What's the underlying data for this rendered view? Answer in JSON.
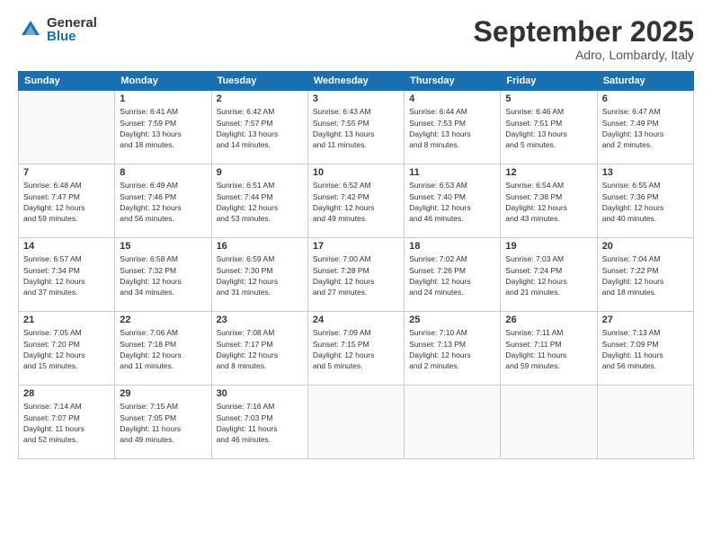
{
  "logo": {
    "general": "General",
    "blue": "Blue"
  },
  "title": "September 2025",
  "location": "Adro, Lombardy, Italy",
  "days_header": [
    "Sunday",
    "Monday",
    "Tuesday",
    "Wednesday",
    "Thursday",
    "Friday",
    "Saturday"
  ],
  "weeks": [
    [
      {
        "day": "",
        "info": ""
      },
      {
        "day": "1",
        "info": "Sunrise: 6:41 AM\nSunset: 7:59 PM\nDaylight: 13 hours\nand 18 minutes."
      },
      {
        "day": "2",
        "info": "Sunrise: 6:42 AM\nSunset: 7:57 PM\nDaylight: 13 hours\nand 14 minutes."
      },
      {
        "day": "3",
        "info": "Sunrise: 6:43 AM\nSunset: 7:55 PM\nDaylight: 13 hours\nand 11 minutes."
      },
      {
        "day": "4",
        "info": "Sunrise: 6:44 AM\nSunset: 7:53 PM\nDaylight: 13 hours\nand 8 minutes."
      },
      {
        "day": "5",
        "info": "Sunrise: 6:46 AM\nSunset: 7:51 PM\nDaylight: 13 hours\nand 5 minutes."
      },
      {
        "day": "6",
        "info": "Sunrise: 6:47 AM\nSunset: 7:49 PM\nDaylight: 13 hours\nand 2 minutes."
      }
    ],
    [
      {
        "day": "7",
        "info": "Sunrise: 6:48 AM\nSunset: 7:47 PM\nDaylight: 12 hours\nand 59 minutes."
      },
      {
        "day": "8",
        "info": "Sunrise: 6:49 AM\nSunset: 7:46 PM\nDaylight: 12 hours\nand 56 minutes."
      },
      {
        "day": "9",
        "info": "Sunrise: 6:51 AM\nSunset: 7:44 PM\nDaylight: 12 hours\nand 53 minutes."
      },
      {
        "day": "10",
        "info": "Sunrise: 6:52 AM\nSunset: 7:42 PM\nDaylight: 12 hours\nand 49 minutes."
      },
      {
        "day": "11",
        "info": "Sunrise: 6:53 AM\nSunset: 7:40 PM\nDaylight: 12 hours\nand 46 minutes."
      },
      {
        "day": "12",
        "info": "Sunrise: 6:54 AM\nSunset: 7:38 PM\nDaylight: 12 hours\nand 43 minutes."
      },
      {
        "day": "13",
        "info": "Sunrise: 6:55 AM\nSunset: 7:36 PM\nDaylight: 12 hours\nand 40 minutes."
      }
    ],
    [
      {
        "day": "14",
        "info": "Sunrise: 6:57 AM\nSunset: 7:34 PM\nDaylight: 12 hours\nand 37 minutes."
      },
      {
        "day": "15",
        "info": "Sunrise: 6:58 AM\nSunset: 7:32 PM\nDaylight: 12 hours\nand 34 minutes."
      },
      {
        "day": "16",
        "info": "Sunrise: 6:59 AM\nSunset: 7:30 PM\nDaylight: 12 hours\nand 31 minutes."
      },
      {
        "day": "17",
        "info": "Sunrise: 7:00 AM\nSunset: 7:28 PM\nDaylight: 12 hours\nand 27 minutes."
      },
      {
        "day": "18",
        "info": "Sunrise: 7:02 AM\nSunset: 7:26 PM\nDaylight: 12 hours\nand 24 minutes."
      },
      {
        "day": "19",
        "info": "Sunrise: 7:03 AM\nSunset: 7:24 PM\nDaylight: 12 hours\nand 21 minutes."
      },
      {
        "day": "20",
        "info": "Sunrise: 7:04 AM\nSunset: 7:22 PM\nDaylight: 12 hours\nand 18 minutes."
      }
    ],
    [
      {
        "day": "21",
        "info": "Sunrise: 7:05 AM\nSunset: 7:20 PM\nDaylight: 12 hours\nand 15 minutes."
      },
      {
        "day": "22",
        "info": "Sunrise: 7:06 AM\nSunset: 7:18 PM\nDaylight: 12 hours\nand 11 minutes."
      },
      {
        "day": "23",
        "info": "Sunrise: 7:08 AM\nSunset: 7:17 PM\nDaylight: 12 hours\nand 8 minutes."
      },
      {
        "day": "24",
        "info": "Sunrise: 7:09 AM\nSunset: 7:15 PM\nDaylight: 12 hours\nand 5 minutes."
      },
      {
        "day": "25",
        "info": "Sunrise: 7:10 AM\nSunset: 7:13 PM\nDaylight: 12 hours\nand 2 minutes."
      },
      {
        "day": "26",
        "info": "Sunrise: 7:11 AM\nSunset: 7:11 PM\nDaylight: 11 hours\nand 59 minutes."
      },
      {
        "day": "27",
        "info": "Sunrise: 7:13 AM\nSunset: 7:09 PM\nDaylight: 11 hours\nand 56 minutes."
      }
    ],
    [
      {
        "day": "28",
        "info": "Sunrise: 7:14 AM\nSunset: 7:07 PM\nDaylight: 11 hours\nand 52 minutes."
      },
      {
        "day": "29",
        "info": "Sunrise: 7:15 AM\nSunset: 7:05 PM\nDaylight: 11 hours\nand 49 minutes."
      },
      {
        "day": "30",
        "info": "Sunrise: 7:16 AM\nSunset: 7:03 PM\nDaylight: 11 hours\nand 46 minutes."
      },
      {
        "day": "",
        "info": ""
      },
      {
        "day": "",
        "info": ""
      },
      {
        "day": "",
        "info": ""
      },
      {
        "day": "",
        "info": ""
      }
    ]
  ]
}
